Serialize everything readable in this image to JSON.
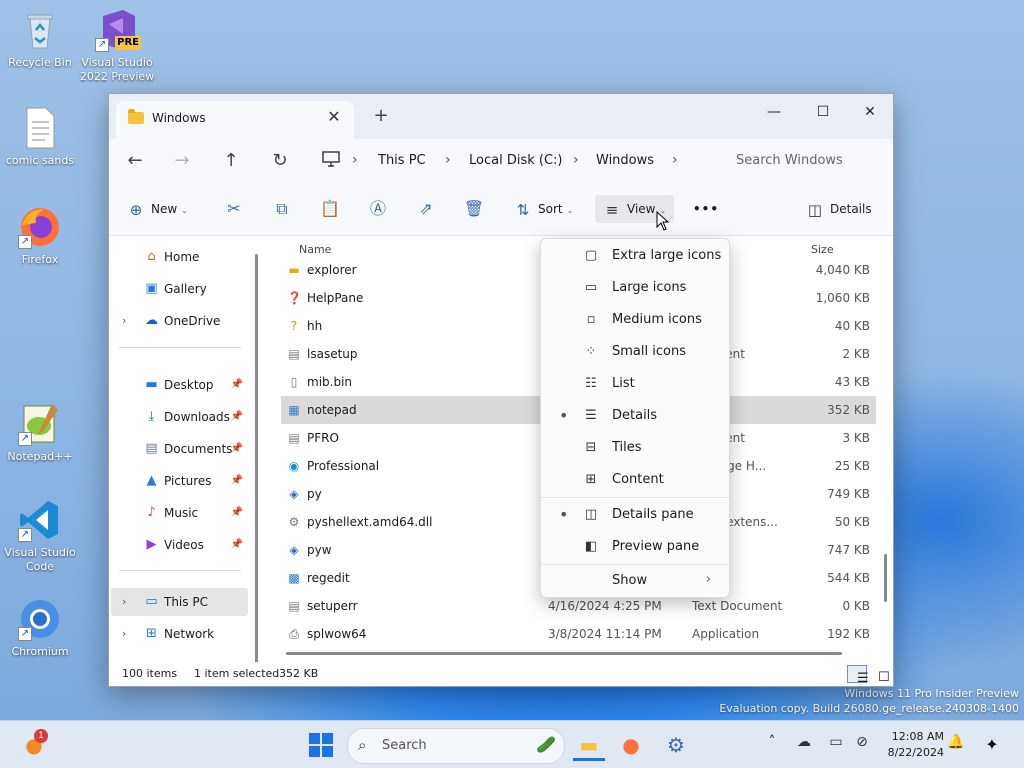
{
  "desktop": {
    "icons": [
      {
        "label": "Recycle Bin",
        "icon": "recycle-bin-icon"
      },
      {
        "label": "Visual Studio 2022 Preview",
        "icon": "visual-studio-preview-icon",
        "badge": "PRE"
      },
      {
        "label": "comic sands",
        "icon": "text-file-icon"
      },
      {
        "label": "Firefox",
        "icon": "firefox-icon"
      },
      {
        "label": "Notepad++",
        "icon": "notepad-plus-plus-icon"
      },
      {
        "label": "Visual Studio Code",
        "icon": "vscode-icon"
      },
      {
        "label": "Chromium",
        "icon": "chromium-icon"
      }
    ],
    "watermark_line1": "Windows 11 Pro Insider Preview",
    "watermark_line2": "Evaluation copy. Build 26080.ge_release.240308-1400"
  },
  "window": {
    "tab_title": "Windows",
    "tab_close": "✕",
    "new_tab": "+",
    "controls": {
      "minimize": "—",
      "maximize": "☐",
      "close": "✕"
    },
    "breadcrumb": [
      "This PC",
      "Local Disk (C:)",
      "Windows"
    ],
    "breadcrumb_sep": "›",
    "search_placeholder": "Search Windows",
    "toolbar": {
      "new_label": "New",
      "sort_label": "Sort",
      "view_label": "View",
      "more_label": "•••",
      "details_label": "Details"
    },
    "nav": {
      "quick": [
        {
          "label": "Home",
          "icon": "home-icon"
        },
        {
          "label": "Gallery",
          "icon": "gallery-icon"
        },
        {
          "label": "OneDrive",
          "icon": "onedrive-icon",
          "expandable": true
        }
      ],
      "pinned": [
        {
          "label": "Desktop",
          "icon": "desktop-folder-icon"
        },
        {
          "label": "Downloads",
          "icon": "downloads-icon"
        },
        {
          "label": "Documents",
          "icon": "documents-icon"
        },
        {
          "label": "Pictures",
          "icon": "pictures-icon"
        },
        {
          "label": "Music",
          "icon": "music-icon"
        },
        {
          "label": "Videos",
          "icon": "videos-icon"
        }
      ],
      "devices": [
        {
          "label": "This PC",
          "icon": "this-pc-icon",
          "selected": true
        },
        {
          "label": "Network",
          "icon": "network-icon"
        }
      ]
    },
    "columns": {
      "name": "Name",
      "size": "Size"
    },
    "files": [
      {
        "name": "explorer",
        "date": "",
        "type": "ation",
        "size": "4,040 KB",
        "icon": "folder-app-icon"
      },
      {
        "name": "HelpPane",
        "date": "",
        "type": "ation",
        "size": "1,060 KB",
        "icon": "help-icon"
      },
      {
        "name": "hh",
        "date": "",
        "type": "ation",
        "size": "40 KB",
        "icon": "help-html-icon"
      },
      {
        "name": "lsasetup",
        "date": "",
        "type": "ocument",
        "size": "2 KB",
        "icon": "text-file-icon"
      },
      {
        "name": "mib.bin",
        "date": "",
        "type": "e",
        "size": "43 KB",
        "icon": "blank-file-icon"
      },
      {
        "name": "notepad",
        "date": "",
        "type": "ation",
        "size": "352 KB",
        "icon": "notepad-icon",
        "selected": true
      },
      {
        "name": "PFRO",
        "date": "",
        "type": "ocument",
        "size": "3 KB",
        "icon": "text-file-icon"
      },
      {
        "name": "Professional",
        "date": "",
        "type": "oft Edge H...",
        "size": "25 KB",
        "icon": "edge-icon"
      },
      {
        "name": "py",
        "date": "",
        "type": "ation",
        "size": "749 KB",
        "icon": "python-icon"
      },
      {
        "name": "pyshellext.amd64.dll",
        "date": "",
        "type": "ation extens...",
        "size": "50 KB",
        "icon": "dll-icon"
      },
      {
        "name": "pyw",
        "date": "",
        "type": "ation",
        "size": "747 KB",
        "icon": "python-icon"
      },
      {
        "name": "regedit",
        "date": "",
        "type": "ation",
        "size": "544 KB",
        "icon": "regedit-icon"
      },
      {
        "name": "setuperr",
        "date": "4/16/2024 4:25 PM",
        "type": "Text Document",
        "size": "0 KB",
        "icon": "text-file-icon"
      },
      {
        "name": "splwow64",
        "date": "3/8/2024 11:14 PM",
        "type": "Application",
        "size": "192 KB",
        "icon": "printer-icon"
      }
    ],
    "status": {
      "items": "100 items",
      "selected": "1 item selected",
      "selected_size": "352 KB"
    }
  },
  "view_menu": {
    "items": [
      {
        "label": "Extra large icons",
        "icon": "extra-large-icons-icon",
        "checked": false
      },
      {
        "label": "Large icons",
        "icon": "large-icons-icon",
        "checked": false
      },
      {
        "label": "Medium icons",
        "icon": "medium-icons-icon",
        "checked": false
      },
      {
        "label": "Small icons",
        "icon": "small-icons-icon",
        "checked": false
      },
      {
        "label": "List",
        "icon": "list-icon",
        "checked": false
      },
      {
        "label": "Details",
        "icon": "details-icon",
        "checked": true
      },
      {
        "label": "Tiles",
        "icon": "tiles-icon",
        "checked": false
      },
      {
        "label": "Content",
        "icon": "content-icon",
        "checked": false
      }
    ],
    "panes": [
      {
        "label": "Details pane",
        "icon": "details-pane-icon",
        "checked": true
      },
      {
        "label": "Preview pane",
        "icon": "preview-pane-icon",
        "checked": false
      }
    ],
    "show_label": "Show"
  },
  "taskbar": {
    "search_label": "Search",
    "notification_badge": "1",
    "time": "12:08 AM",
    "date": "8/22/2024"
  },
  "colors": {
    "accent": "#1a73e8",
    "folder": "#f3c33c",
    "selection": "#dadada"
  }
}
